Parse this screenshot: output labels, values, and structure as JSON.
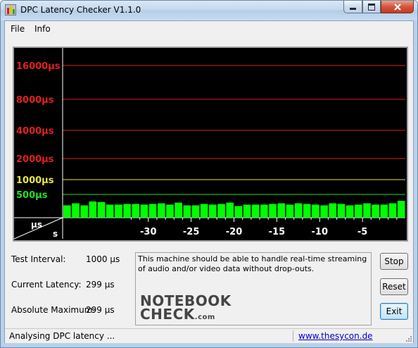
{
  "window": {
    "title": "DPC Latency Checker V1.1.0"
  },
  "menu": {
    "file": "File",
    "info": "Info"
  },
  "graph": {
    "axis_corner_top": "µs",
    "axis_corner_bottom": "s",
    "y_labels": [
      {
        "text": "16000µs",
        "color": "#e02020"
      },
      {
        "text": "8000µs",
        "color": "#e02020"
      },
      {
        "text": "4000µs",
        "color": "#e02020"
      },
      {
        "text": "2000µs",
        "color": "#e02020"
      },
      {
        "text": "1000µs",
        "color": "#e6e640"
      },
      {
        "text": "500µs",
        "color": "#20e020"
      }
    ],
    "x_labels": [
      "-30",
      "-25",
      "-20",
      "-15",
      "-10",
      "-5"
    ],
    "bar_color": "#00ff00",
    "bar_values_us": [
      300,
      330,
      300,
      360,
      350,
      310,
      310,
      320,
      320,
      310,
      320,
      330,
      310,
      340,
      300,
      300,
      320,
      310,
      320,
      340,
      290,
      310,
      310,
      310,
      320,
      330,
      310,
      330,
      320,
      310,
      300,
      330,
      320,
      300,
      310,
      330,
      310,
      310,
      330,
      370
    ]
  },
  "info": {
    "test_interval_label": "Test Interval:",
    "test_interval_value": "1000 µs",
    "current_latency_label": "Current Latency:",
    "current_latency_value": "299 µs",
    "absolute_max_label": "Absolute Maximum:",
    "absolute_max_value": "299 µs"
  },
  "message": "This machine should be able to handle real-time streaming of audio and/or video data without drop-outs.",
  "logo": {
    "line1": "NOTEBOOK",
    "line2": "CHECK",
    "suffix": ".com"
  },
  "buttons": {
    "stop": "Stop",
    "reset": "Reset",
    "exit": "Exit"
  },
  "status": {
    "text": "Analysing DPC latency ...",
    "link": "www.thesycon.de"
  }
}
